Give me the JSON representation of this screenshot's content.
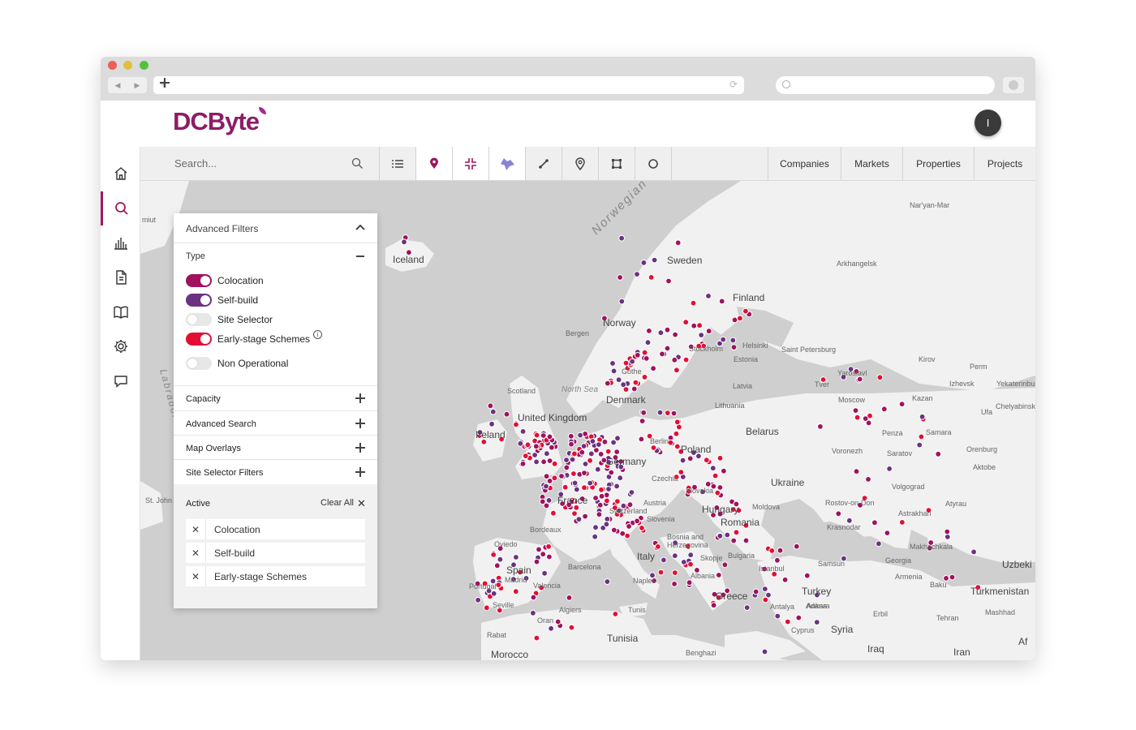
{
  "browser": {
    "url_placeholder": "+",
    "reload": "⟳"
  },
  "app": {
    "logo_text": "DCByte",
    "user_initial": "I"
  },
  "sidebar": {
    "items": [
      {
        "name": "home"
      },
      {
        "name": "search",
        "active": true
      },
      {
        "name": "analytics"
      },
      {
        "name": "reports"
      },
      {
        "name": "library"
      },
      {
        "name": "settings"
      },
      {
        "name": "chat"
      }
    ]
  },
  "toolbar": {
    "search_placeholder": "Search...",
    "links": [
      "Companies",
      "Markets",
      "Properties",
      "Projects"
    ]
  },
  "filters": {
    "title": "Advanced Filters",
    "type_heading": "Type",
    "toggles": [
      {
        "label": "Colocation",
        "on": true,
        "color": "#a0125e"
      },
      {
        "label": "Self-build",
        "on": true,
        "color": "#6a3281"
      },
      {
        "label": "Site Selector",
        "on": false
      },
      {
        "label": "Early-stage Schemes",
        "on": true,
        "color": "#e20f34"
      },
      {
        "label": "Non Operational",
        "on": false
      }
    ],
    "sections": [
      "Capacity",
      "Advanced Search",
      "Map Overlays",
      "Site Selector Filters"
    ],
    "active_heading": "Active",
    "clear_all": "Clear All",
    "active_chips": [
      "Colocation",
      "Self-build",
      "Early-stage Schemes"
    ]
  },
  "map": {
    "labels": [
      "Iceland",
      "Sweden",
      "Finland",
      "Norway",
      "Stockholm",
      "Helsinki",
      "Estonia",
      "Saint Petersburg",
      "Bergen",
      "Gothe",
      "Denmark",
      "North Sea",
      "Scotland",
      "United Kingdom",
      "Ireland",
      "Lithuania",
      "Latvia",
      "Belarus",
      "Berlin",
      "Germany",
      "Poland",
      "France",
      "Czechia",
      "Slovakia",
      "Austria",
      "Hungary",
      "Switzerland",
      "Slovenia",
      "Romania",
      "Moldova",
      "Ukraine",
      "Bosnia and Herzegovina",
      "Italy",
      "Naples",
      "Bulgaria",
      "Skopje",
      "Albania",
      "Greece",
      "Istanbul",
      "Turkey",
      "Ankara",
      "Antalya",
      "Cyprus",
      "Syria",
      "Iraq",
      "Iran",
      "Spain",
      "Portugal",
      "Madrid",
      "Valencia",
      "Barcelona",
      "Bordeaux",
      "Seville",
      "Algiers",
      "Oran",
      "Tunis",
      "Tunisia",
      "Rabat",
      "Morocco",
      "Benghazi",
      "Moscow",
      "Kazan",
      "Samara",
      "Penza",
      "Saratov",
      "Voronezh",
      "Volgograd",
      "Rostov-on-Don",
      "Krasnodar",
      "Astrakhan",
      "Atyrau",
      "Aktobe",
      "Orenburg",
      "Ufa",
      "Chelyabinsk",
      "Yekaterinburg",
      "Izhevsk",
      "Perm",
      "Kirov",
      "Yaroslavl",
      "Tver",
      "Arkhangelsk",
      "Nar'yan-Mar",
      "Georgia",
      "Armenia",
      "Makhachkala",
      "Baku",
      "Turkmenistan",
      "Mashhad",
      "Tehran",
      "Erbil",
      "Uzbeki",
      "Samsun",
      "Adana",
      "Oviedo",
      "Norwegian Sea",
      "Labrador Sea",
      "St. John",
      "Af",
      "miut"
    ]
  }
}
